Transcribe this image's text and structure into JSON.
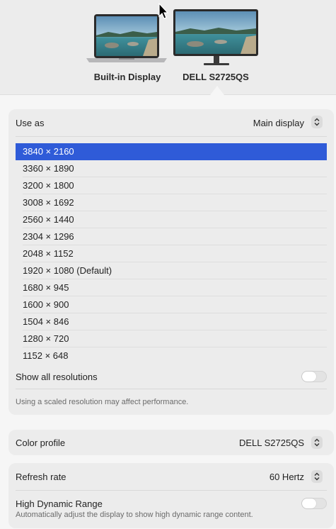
{
  "displays": [
    {
      "label": "Built-in Display",
      "selected": false
    },
    {
      "label": "DELL S2725QS",
      "selected": true
    }
  ],
  "use_as": {
    "label": "Use as",
    "value": "Main display"
  },
  "resolutions": [
    "3840 × 2160",
    "3360 × 1890",
    "3200 × 1800",
    "3008 × 1692",
    "2560 × 1440",
    "2304 × 1296",
    "2048 × 1152",
    "1920 × 1080 (Default)",
    "1680 × 945",
    "1600 × 900",
    "1504 × 846",
    "1280 × 720",
    "1152 × 648"
  ],
  "selected_resolution_index": 0,
  "show_all_resolutions": {
    "label": "Show all resolutions",
    "on": false
  },
  "scaled_note": "Using a scaled resolution may affect performance.",
  "color_profile": {
    "label": "Color profile",
    "value": "DELL S2725QS"
  },
  "refresh_rate": {
    "label": "Refresh rate",
    "value": "60 Hertz"
  },
  "hdr": {
    "label": "High Dynamic Range",
    "description": "Automatically adjust the display to show high dynamic range content.",
    "on": false
  },
  "colors": {
    "selection": "#2f5bd8"
  },
  "icons": {
    "stepper": "chevron-up-down-icon",
    "laptop": "laptop-icon",
    "monitor": "monitor-icon",
    "cursor": "mouse-pointer-icon"
  }
}
